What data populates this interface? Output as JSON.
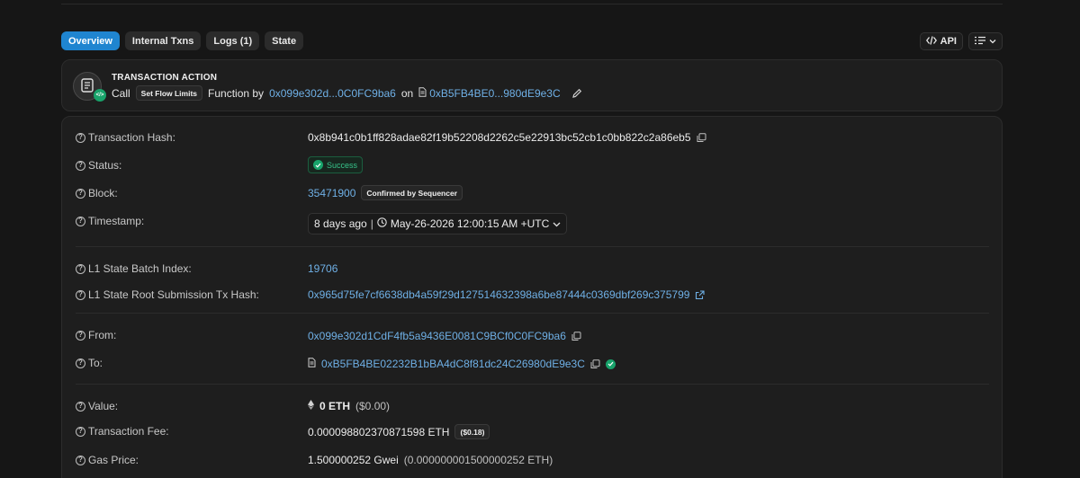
{
  "tabs": [
    {
      "label": "Overview",
      "active": true
    },
    {
      "label": "Internal Txns",
      "active": false
    },
    {
      "label": "Logs (1)",
      "active": false
    },
    {
      "label": "State",
      "active": false
    }
  ],
  "tools": {
    "api_label": "API"
  },
  "action": {
    "heading": "TRANSACTION ACTION",
    "call_word": "Call",
    "method": "Set Flow Limits",
    "function_by": "Function by",
    "caller": "0x099e302d...0C0FC9ba6",
    "on_word": "on",
    "contract": "0xB5FB4BE0...980dE9e3C"
  },
  "fields": {
    "tx_hash": {
      "label": "Transaction Hash:",
      "value": "0x8b941c0b1ff828adae82f19b52208d2262c5e22913bc52cb1c0bb822c2a86eb5"
    },
    "status": {
      "label": "Status:",
      "value": "Success"
    },
    "block": {
      "label": "Block:",
      "value": "35471900",
      "badge": "Confirmed by Sequencer"
    },
    "timestamp": {
      "label": "Timestamp:",
      "relative": "8 days ago",
      "separator": "|",
      "absolute": "May-26-2026 12:00:15 AM +UTC"
    },
    "batch_index": {
      "label": "L1 State Batch Index:",
      "value": "19706"
    },
    "root_hash": {
      "label": "L1 State Root Submission Tx Hash:",
      "value": "0x965d75fe7cf6638db4a59f29d127514632398a6be87444c0369dbf269c375799"
    },
    "from": {
      "label": "From:",
      "value": "0x099e302d1CdF4fb5a9436E0081C9BCf0C0FC9ba6"
    },
    "to": {
      "label": "To:",
      "value": "0xB5FB4BE02232B1bBA4dC8f81dc24C26980dE9e3C"
    },
    "value": {
      "label": "Value:",
      "amount": "0 ETH",
      "usd": "($0.00)"
    },
    "fee": {
      "label": "Transaction Fee:",
      "amount": "0.000098802370871598 ETH",
      "usd": "($0.18)"
    },
    "gas": {
      "label": "Gas Price:",
      "amount": "1.500000252 Gwei",
      "eth": "(0.000000001500000252 ETH)"
    }
  },
  "colors": {
    "accent": "#1f85d0",
    "link": "#6fb0e6",
    "success": "#37c38a",
    "background": "#161616",
    "card": "#1e1e1e"
  },
  "icons": [
    "code-icon",
    "list-settings-icon",
    "chevron-down-icon",
    "document-icon",
    "edit-icon",
    "question-icon",
    "copy-icon",
    "check-circle-icon",
    "clock-icon",
    "external-link-icon",
    "ethereum-icon"
  ]
}
